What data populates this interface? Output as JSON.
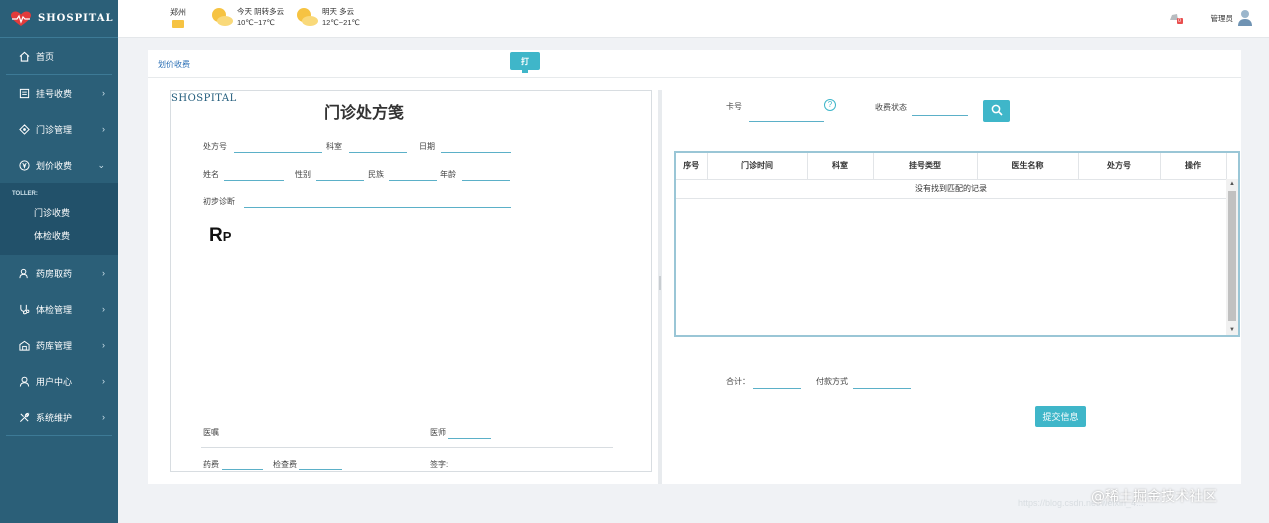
{
  "brand": "SHOSPITAL",
  "header": {
    "city": "郑州",
    "today": {
      "label": "今天",
      "weather": "阴转多云",
      "temp": "10℃~17℃"
    },
    "tomorrow": {
      "label": "明天",
      "weather": "多云",
      "temp": "12℃~21℃"
    },
    "badge": "0",
    "user": "管理员"
  },
  "sidebar": {
    "home": "首页",
    "items": [
      {
        "label": "挂号收费"
      },
      {
        "label": "门诊管理"
      },
      {
        "label": "划价收费"
      }
    ],
    "submenu_caption": "TOLLER:",
    "submenu": [
      "门诊收费",
      "体检收费"
    ],
    "items2": [
      {
        "label": "药房取药"
      },
      {
        "label": "体检管理"
      },
      {
        "label": "药库管理"
      },
      {
        "label": "用户中心"
      },
      {
        "label": "系统维护"
      }
    ]
  },
  "card": {
    "title": "划价收费",
    "print_label": "打"
  },
  "prescription": {
    "hospital": "SHOSPITAL",
    "title": "门诊处方笺",
    "labels": {
      "rx_no": "处方号",
      "dept": "科室",
      "date": "日期",
      "name": "姓名",
      "gender": "性别",
      "ethnic": "民族",
      "age": "年龄",
      "diagnosis": "初步诊断",
      "advice": "医嘱",
      "doctor": "医师",
      "drug_fee": "药费",
      "exam_fee": "检查费",
      "sign": "签字:"
    },
    "rp_main": "R",
    "rp_sub": "P"
  },
  "query": {
    "card_label": "卡号",
    "status_label": "收费状态"
  },
  "table": {
    "columns": [
      "序号",
      "门诊时间",
      "科室",
      "挂号类型",
      "医生名称",
      "处方号",
      "操作"
    ],
    "empty": "没有找到匹配的记录"
  },
  "footer": {
    "total_label": "合计：",
    "pay_label": "付款方式",
    "submit_label": "提交信息"
  },
  "watermark": "@稀土掘金技术社区",
  "watermark_url": "https://blog.csdn.net/weixin_4..."
}
